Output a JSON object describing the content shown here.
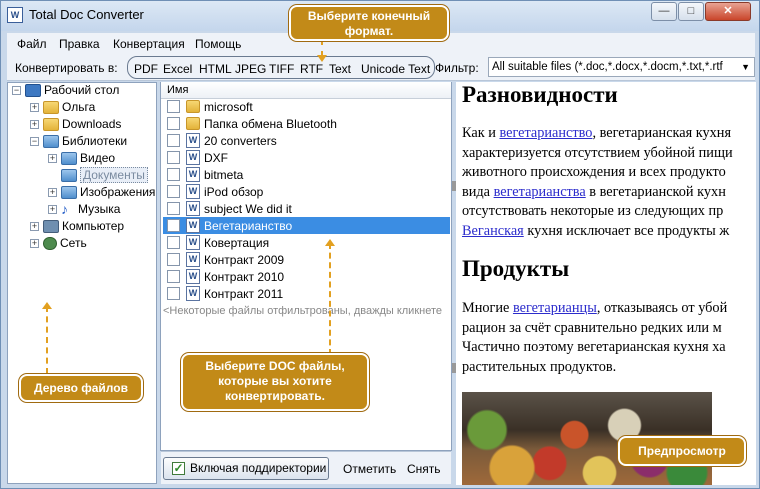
{
  "window": {
    "title": "Total Doc Converter",
    "minimize": "—",
    "maximize": "□",
    "close": "✕"
  },
  "menu": [
    "Файл",
    "Правка",
    "Конвертация",
    "Помощь"
  ],
  "toolbar": {
    "convert_label": "Конвертировать в:",
    "formats": [
      "PDF",
      "Excel",
      "HTML",
      "JPEG",
      "TIFF",
      "RTF",
      "Text",
      "Unicode Text"
    ],
    "filter_label": "Фильтр:",
    "filter_value": "All suitable files (*.doc,*.docx,*.docm,*.txt,*.rtf"
  },
  "tree": [
    {
      "label": "Рабочий стол",
      "icon": "desktop-icon",
      "expander": "−"
    },
    {
      "label": "Ольга",
      "icon": "folder-icon",
      "expander": "+"
    },
    {
      "label": "Downloads",
      "icon": "folder-icon",
      "expander": "+"
    },
    {
      "label": "Библиотеки",
      "icon": "library-icon",
      "expander": "−"
    },
    {
      "label": "Видео",
      "icon": "library-icon",
      "expander": "+"
    },
    {
      "label": "Документы",
      "icon": "library-icon",
      "expander": ""
    },
    {
      "label": "Изображения",
      "icon": "library-icon",
      "expander": "+"
    },
    {
      "label": "Музыка",
      "icon": "music-icon",
      "expander": "+"
    },
    {
      "label": "Компьютер",
      "icon": "computer-icon",
      "expander": "+"
    },
    {
      "label": "Сеть",
      "icon": "network-icon",
      "expander": "+"
    }
  ],
  "file_list": {
    "header": "Имя",
    "rows": [
      {
        "name": "microsoft",
        "type": "folder"
      },
      {
        "name": "Папка обмена Bluetooth",
        "type": "folder"
      },
      {
        "name": "20 converters",
        "type": "doc"
      },
      {
        "name": "DXF",
        "type": "doc"
      },
      {
        "name": "bitmeta",
        "type": "doc"
      },
      {
        "name": "iPod обзор",
        "type": "doc"
      },
      {
        "name": "subject We did it",
        "type": "doc"
      },
      {
        "name": "Вегетарианство",
        "type": "doc",
        "selected": true
      },
      {
        "name": "Ковертация",
        "type": "doc"
      },
      {
        "name": "Контракт 2009",
        "type": "doc"
      },
      {
        "name": "Контракт 2010",
        "type": "doc"
      },
      {
        "name": "Контракт 2011",
        "type": "doc"
      }
    ],
    "hint": "<Некоторые файлы отфильтрованы, дважды кликнете"
  },
  "bottom": {
    "include_subdirs": "Включая поддиректории",
    "check": "Отметить",
    "uncheck": "Снять",
    "checkmark": "✓"
  },
  "preview": {
    "heading1": "Разновидности",
    "p1": [
      {
        "parts": [
          {
            "t": "Как и "
          },
          {
            "t": "вегетарианство",
            "link": true
          },
          {
            "t": ", вегетарианская кухня"
          }
        ]
      },
      {
        "parts": [
          {
            "t": "характеризуется отсутствием убойной пищи"
          }
        ]
      },
      {
        "parts": [
          {
            "t": "животного происхождения и всех продукто"
          }
        ]
      },
      {
        "parts": [
          {
            "t": "вида "
          },
          {
            "t": "вегетарианства",
            "link": true
          },
          {
            "t": " в вегетарианской кухн"
          }
        ]
      },
      {
        "parts": [
          {
            "t": "отсутствовать некоторые из следующих пр"
          }
        ]
      },
      {
        "parts": [
          {
            "t": "Веганская",
            "link": true
          },
          {
            "t": " кухня исключает все продукты ж"
          }
        ]
      }
    ],
    "heading2": "Продукты",
    "p2": [
      {
        "parts": [
          {
            "t": "Многие "
          },
          {
            "t": "вегетарианцы",
            "link": true
          },
          {
            "t": ", отказываясь от убой"
          }
        ]
      },
      {
        "parts": [
          {
            "t": "рацион за счёт сравнительно редких или м"
          }
        ]
      },
      {
        "parts": [
          {
            "t": "Частично поэтому вегетарианская кухня ха"
          }
        ]
      },
      {
        "parts": [
          {
            "t": "растительных продуктов."
          }
        ]
      }
    ]
  },
  "callouts": {
    "format": "Выберите конечный формат.",
    "tree": "Дерево файлов",
    "files": "Выберите DOC файлы, которые вы хотите конвертировать.",
    "preview": "Предпросмотр"
  },
  "colors": {
    "callout": "#c28a18",
    "selection": "#3b8de3",
    "link": "#2c2ccc"
  }
}
